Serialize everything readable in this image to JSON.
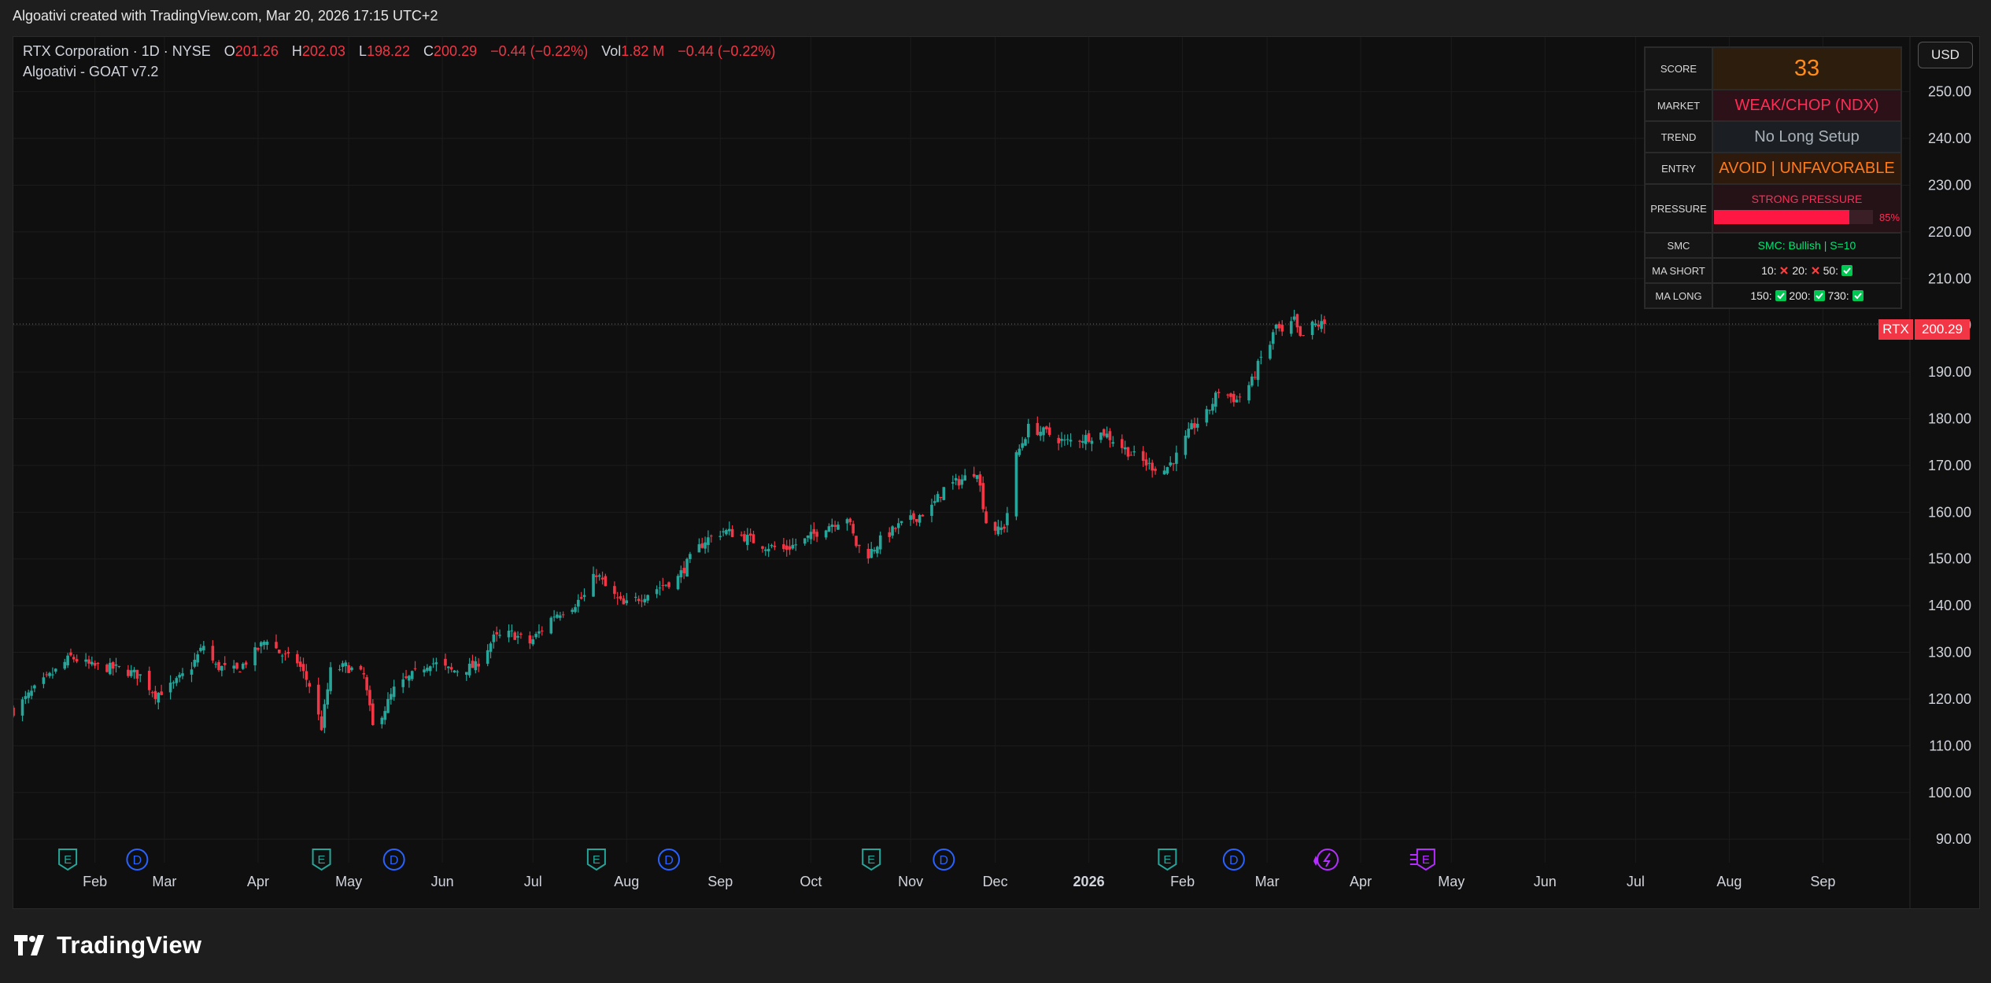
{
  "header": {
    "credit": "Algoativi created with TradingView.com, Mar 20, 2026 17:15 UTC+2"
  },
  "legend": {
    "symbol": "RTX Corporation · 1D · NYSE",
    "o_label": "O",
    "o_value": "201.26",
    "h_label": "H",
    "h_value": "202.03",
    "l_label": "L",
    "l_value": "198.22",
    "c_label": "C",
    "c_value": "200.29",
    "change": "−0.44 (−0.22%)",
    "vol_label": "Vol",
    "vol_value": "1.82 M",
    "vol_change": "−0.44 (−0.22%)"
  },
  "indicator": {
    "name": "Algoativi - GOAT v7.2"
  },
  "currency_button": {
    "label": "USD"
  },
  "price_badge": {
    "symbol": "RTX",
    "price": "200.29"
  },
  "table": {
    "score": {
      "label": "SCORE",
      "value": "33"
    },
    "market": {
      "label": "MARKET",
      "value": "WEAK/CHOP (NDX)"
    },
    "trend": {
      "label": "TREND",
      "value": "No Long Setup"
    },
    "entry": {
      "label": "ENTRY",
      "value": "AVOID | UNFAVORABLE"
    },
    "pressure": {
      "label": "PRESSURE",
      "value": "STRONG PRESSURE",
      "percent_text": "85%",
      "fraction": 0.85
    },
    "smc": {
      "label": "SMC",
      "value": "SMC: Bullish | S=10"
    },
    "ma_short": {
      "label": "MA SHORT",
      "items": [
        {
          "text": "10:",
          "status": "fail"
        },
        {
          "text": "20:",
          "status": "fail"
        },
        {
          "text": "50:",
          "status": "pass"
        }
      ]
    },
    "ma_long": {
      "label": "MA LONG",
      "items": [
        {
          "text": "150:",
          "status": "pass"
        },
        {
          "text": "200:",
          "status": "pass"
        },
        {
          "text": "730:",
          "status": "pass"
        }
      ]
    }
  },
  "colors": {
    "up": "#26a69a",
    "down": "#f23645",
    "score_text": "#ff8c1a",
    "pressure": "#ff1744",
    "smc": "#00e676",
    "event_earnings": "#26a69a",
    "event_dividend": "#2962ff",
    "event_future": "#b32eff"
  },
  "events": [
    {
      "type": "E",
      "date": "2025-01-28"
    },
    {
      "type": "D",
      "date": "2025-02-20"
    },
    {
      "type": "E",
      "date": "2025-04-22"
    },
    {
      "type": "D",
      "date": "2025-05-16"
    },
    {
      "type": "E",
      "date": "2025-07-22"
    },
    {
      "type": "D",
      "date": "2025-08-15"
    },
    {
      "type": "E",
      "date": "2025-10-21"
    },
    {
      "type": "D",
      "date": "2025-11-14"
    },
    {
      "type": "E",
      "date": "2026-01-27"
    },
    {
      "type": "D",
      "date": "2026-02-18"
    },
    {
      "type": "split-icon",
      "date": "2026-03-20"
    },
    {
      "type": "E-future",
      "date": "2026-04-21"
    }
  ],
  "chart_data": {
    "type": "candlestick",
    "symbol": "RTX",
    "interval": "1D",
    "x_range": [
      "2025-01-10",
      "2026-09-22"
    ],
    "x_tick_labels": [
      {
        "date": "2025-02-06",
        "label": "Feb"
      },
      {
        "date": "2025-03-01",
        "label": "Mar"
      },
      {
        "date": "2025-04-01",
        "label": "Apr"
      },
      {
        "date": "2025-05-01",
        "label": "May"
      },
      {
        "date": "2025-06-01",
        "label": "Jun"
      },
      {
        "date": "2025-07-01",
        "label": "Jul"
      },
      {
        "date": "2025-08-01",
        "label": "Aug"
      },
      {
        "date": "2025-09-01",
        "label": "Sep"
      },
      {
        "date": "2025-10-01",
        "label": "Oct"
      },
      {
        "date": "2025-11-03",
        "label": "Nov"
      },
      {
        "date": "2025-12-01",
        "label": "Dec"
      },
      {
        "date": "2026-01-01",
        "label": "2026"
      },
      {
        "date": "2026-02-01",
        "label": "Feb"
      },
      {
        "date": "2026-03-01",
        "label": "Mar"
      },
      {
        "date": "2026-04-01",
        "label": "Apr"
      },
      {
        "date": "2026-05-01",
        "label": "May"
      },
      {
        "date": "2026-06-01",
        "label": "Jun"
      },
      {
        "date": "2026-07-01",
        "label": "Jul"
      },
      {
        "date": "2026-08-01",
        "label": "Aug"
      },
      {
        "date": "2026-09-01",
        "label": "Sep"
      }
    ],
    "y_range": [
      87,
      256
    ],
    "y_ticks": [
      90,
      100,
      110,
      120,
      130,
      140,
      150,
      160,
      170,
      180,
      190,
      200,
      210,
      220,
      230,
      240,
      250
    ],
    "y_tick_labels": [
      "90.00",
      "100.00",
      "110.00",
      "120.00",
      "130.00",
      "140.00",
      "150.00",
      "160.00",
      "170.00",
      "180.00",
      "190.00",
      "200.00",
      "210.00",
      "220.00",
      "230.00",
      "240.00",
      "250.00"
    ],
    "last_price": 200.29,
    "start_date": "2025-01-10",
    "end_date": "2026-03-20",
    "close_path": [
      [
        "2025-01-10",
        117.5
      ],
      [
        "2025-01-17",
        122
      ],
      [
        "2025-01-24",
        126
      ],
      [
        "2025-01-29",
        129
      ],
      [
        "2025-02-05",
        127
      ],
      [
        "2025-02-14",
        126.5
      ],
      [
        "2025-02-21",
        125
      ],
      [
        "2025-02-26",
        121
      ],
      [
        "2025-03-04",
        123
      ],
      [
        "2025-03-10",
        127
      ],
      [
        "2025-03-14",
        131.5
      ],
      [
        "2025-03-18",
        127
      ],
      [
        "2025-03-25",
        126
      ],
      [
        "2025-03-31",
        130
      ],
      [
        "2025-04-04",
        133
      ],
      [
        "2025-04-08",
        130
      ],
      [
        "2025-04-10",
        129
      ],
      [
        "2025-04-14",
        128
      ],
      [
        "2025-04-18",
        123
      ],
      [
        "2025-04-22",
        114
      ],
      [
        "2025-04-25",
        126
      ],
      [
        "2025-04-30",
        127
      ],
      [
        "2025-05-06",
        125
      ],
      [
        "2025-05-09",
        114
      ],
      [
        "2025-05-13",
        118
      ],
      [
        "2025-05-16",
        122
      ],
      [
        "2025-05-22",
        125
      ],
      [
        "2025-05-28",
        128
      ],
      [
        "2025-06-04",
        126
      ],
      [
        "2025-06-12",
        127
      ],
      [
        "2025-06-18",
        133
      ],
      [
        "2025-06-24",
        134
      ],
      [
        "2025-06-30",
        132
      ],
      [
        "2025-07-08",
        138
      ],
      [
        "2025-07-14",
        140
      ],
      [
        "2025-07-18",
        142
      ],
      [
        "2025-07-22",
        147
      ],
      [
        "2025-07-25",
        144
      ],
      [
        "2025-07-31",
        140
      ],
      [
        "2025-08-06",
        142
      ],
      [
        "2025-08-12",
        144
      ],
      [
        "2025-08-18",
        146
      ],
      [
        "2025-08-22",
        150
      ],
      [
        "2025-08-27",
        154
      ],
      [
        "2025-09-02",
        156
      ],
      [
        "2025-09-08",
        155
      ],
      [
        "2025-09-15",
        153
      ],
      [
        "2025-09-22",
        152
      ],
      [
        "2025-09-29",
        154
      ],
      [
        "2025-10-06",
        157
      ],
      [
        "2025-10-13",
        159
      ],
      [
        "2025-10-16",
        153
      ],
      [
        "2025-10-20",
        151
      ],
      [
        "2025-10-24",
        154
      ],
      [
        "2025-10-30",
        157
      ],
      [
        "2025-11-05",
        159
      ],
      [
        "2025-11-10",
        161
      ],
      [
        "2025-11-14",
        165
      ],
      [
        "2025-11-20",
        167
      ],
      [
        "2025-11-25",
        169
      ],
      [
        "2025-11-28",
        158
      ],
      [
        "2025-12-02",
        156
      ],
      [
        "2025-12-04",
        157
      ],
      [
        "2025-12-05",
        160
      ],
      [
        "2025-12-08",
        172
      ],
      [
        "2025-12-12",
        178
      ],
      [
        "2025-12-18",
        177
      ],
      [
        "2025-12-24",
        175
      ],
      [
        "2025-12-31",
        176
      ],
      [
        "2026-01-06",
        177
      ],
      [
        "2026-01-12",
        174
      ],
      [
        "2026-01-16",
        172
      ],
      [
        "2026-01-21",
        170
      ],
      [
        "2026-01-26",
        169
      ],
      [
        "2026-01-30",
        172
      ],
      [
        "2026-02-04",
        178
      ],
      [
        "2026-02-09",
        181
      ],
      [
        "2026-02-13",
        186
      ],
      [
        "2026-02-19",
        184
      ],
      [
        "2026-02-24",
        188
      ],
      [
        "2026-02-27",
        193
      ],
      [
        "2026-03-02",
        196
      ],
      [
        "2026-03-04",
        200
      ],
      [
        "2026-03-06",
        198
      ],
      [
        "2026-03-10",
        201
      ],
      [
        "2026-03-12",
        197
      ],
      [
        "2026-03-16",
        200
      ],
      [
        "2026-03-20",
        200.29
      ]
    ]
  }
}
